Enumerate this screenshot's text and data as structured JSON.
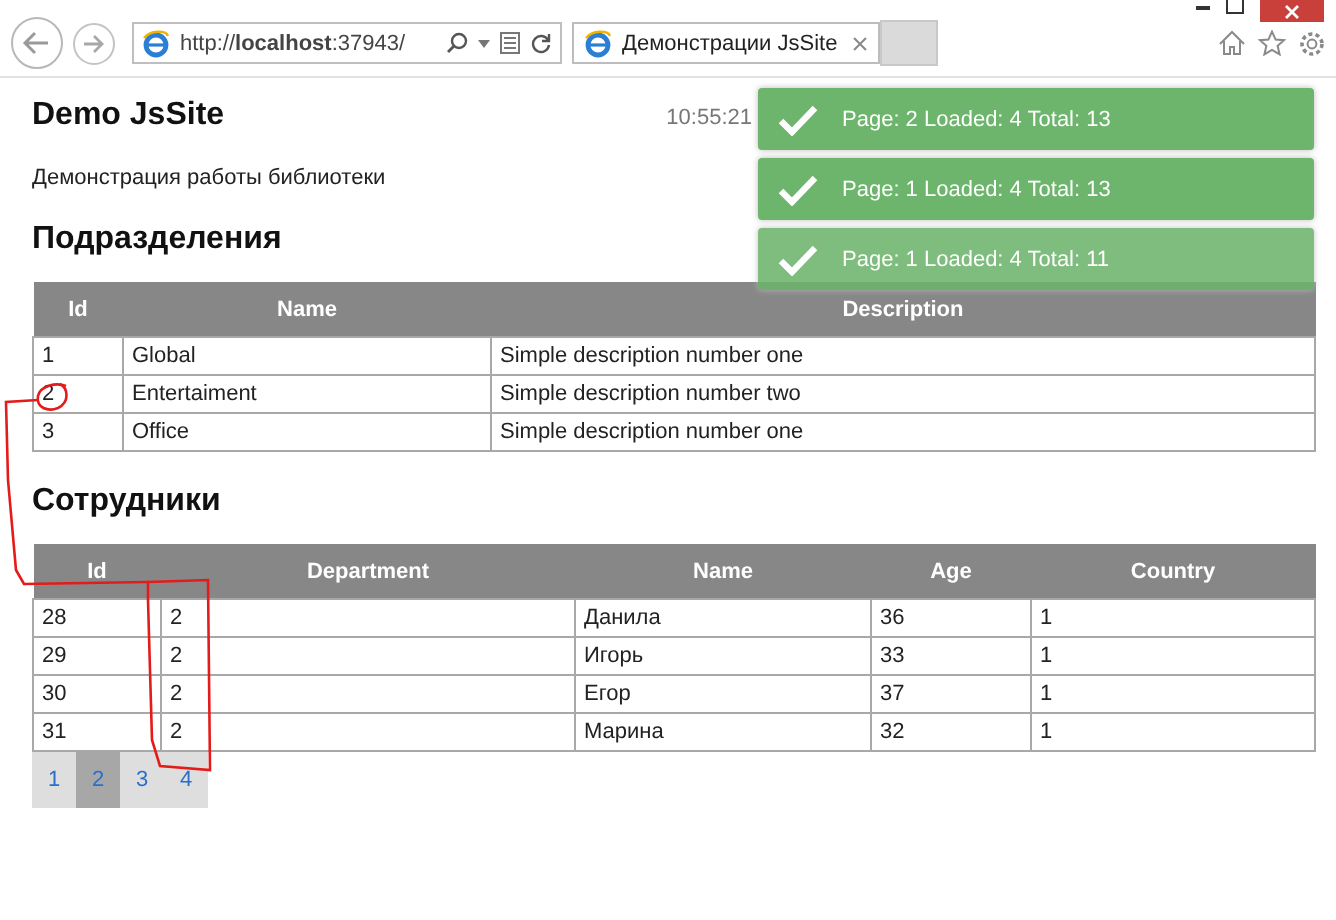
{
  "browser": {
    "address": "http://**localhost**:37943/",
    "tabs": [
      {
        "title": "Демонстрации JsSite",
        "selected": true
      }
    ]
  },
  "page": {
    "title": "Demo JsSite",
    "time": "10:55:21",
    "subtitle": "Демонстрация работы библиотеки"
  },
  "toasts": [
    {
      "text": "Page: 2 Loaded: 4 Total: 13"
    },
    {
      "text": "Page: 1 Loaded: 4 Total: 13"
    },
    {
      "text": "Page: 1 Loaded: 4 Total: 11"
    }
  ],
  "departments": {
    "heading": "Подразделения",
    "columns": [
      "Id",
      "Name",
      "Description"
    ],
    "rows": [
      [
        "1",
        "Global",
        "Simple description number one"
      ],
      [
        "2",
        "Entertaiment",
        "Simple description number two"
      ],
      [
        "3",
        "Office",
        "Simple description number one"
      ]
    ]
  },
  "employees": {
    "heading": "Сотрудники",
    "columns": [
      "Id",
      "Department",
      "Name",
      "Age",
      "Country"
    ],
    "rows": [
      [
        "28",
        "2",
        "Данила",
        "36",
        "1"
      ],
      [
        "29",
        "2",
        "Игорь",
        "33",
        "1"
      ],
      [
        "30",
        "2",
        "Егор",
        "37",
        "1"
      ],
      [
        "31",
        "2",
        "Марина",
        "32",
        "1"
      ]
    ]
  },
  "pager": [
    {
      "label": "1",
      "selected": false
    },
    {
      "label": "2",
      "selected": true
    },
    {
      "label": "3",
      "selected": false
    },
    {
      "label": "4",
      "selected": false
    }
  ]
}
